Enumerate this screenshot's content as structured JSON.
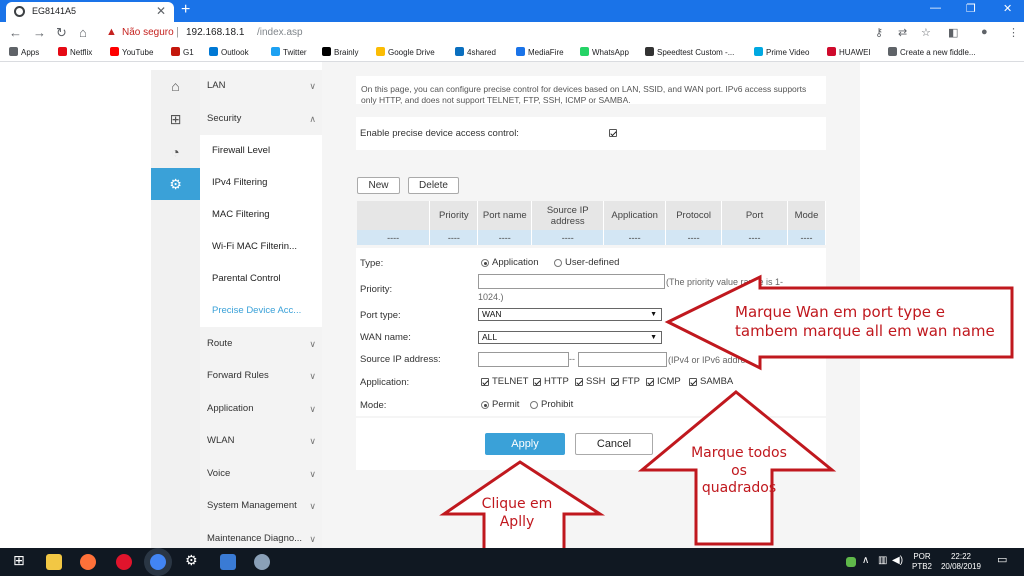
{
  "browser": {
    "tab_title": "EG8141A5",
    "tab_close": "✕",
    "new_tab": "+",
    "window_controls": [
      "—",
      "❐",
      "✕"
    ],
    "address": {
      "warning_icon": "warning-icon",
      "insecure_label": "Não seguro",
      "separator": "|",
      "host": "192.168.18.1",
      "path": "/index.asp"
    },
    "bookmarks": [
      {
        "label": "Apps",
        "color": "#5f6368"
      },
      {
        "label": "Netflix",
        "color": "#e50914"
      },
      {
        "label": "YouTube",
        "color": "#ff0000"
      },
      {
        "label": "G1",
        "color": "#c4170c"
      },
      {
        "label": "Outlook",
        "color": "#0078d4"
      },
      {
        "label": "Twitter",
        "color": "#1da1f2"
      },
      {
        "label": "Brainly",
        "color": "#000000"
      },
      {
        "label": "Google Drive",
        "color": "#fbbc04"
      },
      {
        "label": "4shared",
        "color": "#0a6fbf"
      },
      {
        "label": "MediaFire",
        "color": "#1a73e8"
      },
      {
        "label": "WhatsApp",
        "color": "#25d366"
      },
      {
        "label": "Speedtest Custom -...",
        "color": "#333333"
      },
      {
        "label": "Prime Video",
        "color": "#00a8e1"
      },
      {
        "label": "HUAWEI",
        "color": "#cf0a2c"
      },
      {
        "label": "Create a new fiddle...",
        "color": "#5f6368"
      }
    ]
  },
  "rail_icons": [
    "home-icon",
    "plus-box-icon",
    "pulse-icon",
    "gear-icon"
  ],
  "menu": {
    "lan": "LAN",
    "security": "Security",
    "security_sub": [
      "Firewall Level",
      "IPv4 Filtering",
      "MAC Filtering",
      "Wi-Fi MAC Filterin...",
      "Parental Control",
      "Precise Device Acc..."
    ],
    "rest": [
      "Route",
      "Forward Rules",
      "Application",
      "WLAN",
      "Voice",
      "System Management",
      "Maintenance Diagno..."
    ]
  },
  "page": {
    "description": "On this page, you can configure precise control for devices based on LAN, SSID, and WAN port. IPv6 access supports only HTTP, and does not support TELNET, FTP, SSH, ICMP or SAMBA.",
    "enable_label": "Enable precise device access control:",
    "new_button": "New",
    "delete_button": "Delete",
    "table": {
      "headers": [
        "",
        "Priority",
        "Port name",
        "Source IP address",
        "Application",
        "Protocol",
        "Port",
        "Mode"
      ],
      "row": [
        "----",
        "----",
        "----",
        "----",
        "----",
        "----",
        "----",
        "----"
      ]
    },
    "form": {
      "type_label": "Type:",
      "type_options": [
        "Application",
        "User-defined"
      ],
      "priority_label": "Priority:",
      "priority_hint": "(The priority value range is 1-",
      "priority_hint2": "1024.)",
      "port_type_label": "Port type:",
      "port_type_value": "WAN",
      "wan_name_label": "WAN name:",
      "wan_name_value": "ALL",
      "source_ip_label": "Source IP address:",
      "ip_dash": "--",
      "source_ip_hint": "(IPv4 or IPv6 address)",
      "application_label": "Application:",
      "applications": [
        "TELNET",
        "HTTP",
        "SSH",
        "FTP",
        "ICMP",
        "SAMBA"
      ],
      "mode_label": "Mode:",
      "mode_options": [
        "Permit",
        "Prohibit"
      ]
    },
    "apply_button": "Apply",
    "cancel_button": "Cancel"
  },
  "annotations": {
    "wan_note_line1": "Marque Wan em port type e",
    "wan_note_line2": "tambem marque all em wan name",
    "boxes_note_line1": "Marque todos",
    "boxes_note_line2": "os",
    "boxes_note_line3": "quadrados",
    "apply_note_line1": "Clique em",
    "apply_note_line2": "Aplly"
  },
  "taskbar": {
    "language": "POR",
    "layout": "PTB2",
    "time": "22:22",
    "date": "20/08/2019"
  }
}
